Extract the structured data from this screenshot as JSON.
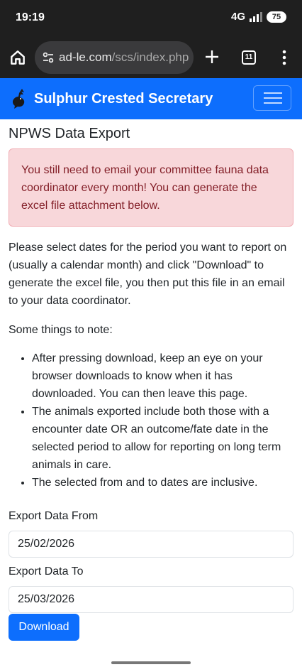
{
  "status_bar": {
    "time": "19:19",
    "network": "4G",
    "battery": "75"
  },
  "browser": {
    "url_domain": "ad-le.com",
    "url_path": "/scs/index.php",
    "tab_count": "11"
  },
  "navbar": {
    "brand": "Sulphur Crested Secretary",
    "color": "#0d6efd"
  },
  "page": {
    "title": "NPWS Data Export",
    "alert": "You still need to email your committee fauna data coordinator every month! You can generate the excel file attachment below.",
    "intro": "Please select dates for the period you want to report on (usually a calendar month) and click \"Download\" to generate the excel file, you then put this file in an email to your data coordinator.",
    "notes_heading": "Some things to note:",
    "notes": [
      "After pressing download, keep an eye on your browser downloads to know when it has downloaded. You can then leave this page.",
      "The animals exported include both those with a encounter date OR an outcome/fate date in the selected period to allow for reporting on long term animals in care.",
      "The selected from and to dates are inclusive."
    ]
  },
  "form": {
    "from_label": "Export Data From",
    "from_value": "25/02/2026",
    "to_label": "Export Data To",
    "to_value": "25/03/2026",
    "download_label": "Download"
  }
}
